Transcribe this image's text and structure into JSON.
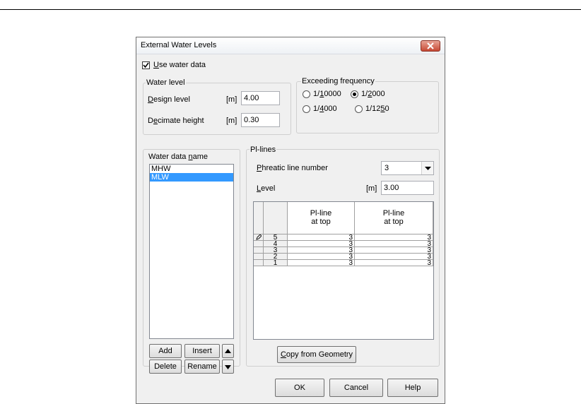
{
  "window": {
    "title": "External Water Levels"
  },
  "use_water_data": {
    "label_pre": "",
    "label_ul": "U",
    "label_post": "se water data",
    "checked": true
  },
  "water_level": {
    "legend": "Water level",
    "design_level": {
      "label_ul": "D",
      "label_post": "esign level",
      "unit": "[m]",
      "value": "4.00"
    },
    "decimate_height": {
      "label_pre": "D",
      "label_ul": "e",
      "label_post": "cimate height",
      "unit": "[m]",
      "value": "0.30"
    }
  },
  "exceeding_frequency": {
    "legend": "Exceeding frequency",
    "options": [
      {
        "pre": "1/",
        "ul": "1",
        "post": "0000",
        "selected": false
      },
      {
        "pre": "1/",
        "ul": "2",
        "post": "000",
        "selected": true
      },
      {
        "pre": "1/",
        "ul": "4",
        "post": "000",
        "selected": false
      },
      {
        "pre": "1/12",
        "ul": "5",
        "post": "0",
        "selected": false
      }
    ]
  },
  "water_data": {
    "label_pre": "Water data ",
    "label_ul": "n",
    "label_post": "ame",
    "items": [
      "MHW",
      "MLW"
    ],
    "selected_index": 1,
    "buttons": {
      "add": "Add",
      "insert": "Insert",
      "delete": "Delete",
      "rename": "Rename"
    }
  },
  "pl_lines": {
    "legend": "Pl-lines",
    "phreatic": {
      "label_ul": "P",
      "label_post": "hreatic line number",
      "value": "3"
    },
    "level": {
      "label_ul": "L",
      "label_post": "evel",
      "unit": "[m]",
      "value": "3.00"
    },
    "table": {
      "col1_header": [
        "Pl-line",
        "at top"
      ],
      "col2_header": [
        "Pl-line",
        "at top"
      ],
      "rows": [
        {
          "id": "5",
          "c1": "3",
          "c2": "3"
        },
        {
          "id": "4",
          "c1": "3",
          "c2": "3"
        },
        {
          "id": "3",
          "c1": "3",
          "c2": "3"
        },
        {
          "id": "2",
          "c1": "3",
          "c2": "3"
        },
        {
          "id": "1",
          "c1": "3",
          "c2": "3"
        }
      ]
    },
    "copy_button": {
      "ul": "C",
      "post": "opy from Geometry"
    }
  },
  "footer": {
    "ok": "OK",
    "cancel": "Cancel",
    "help": "Help"
  }
}
